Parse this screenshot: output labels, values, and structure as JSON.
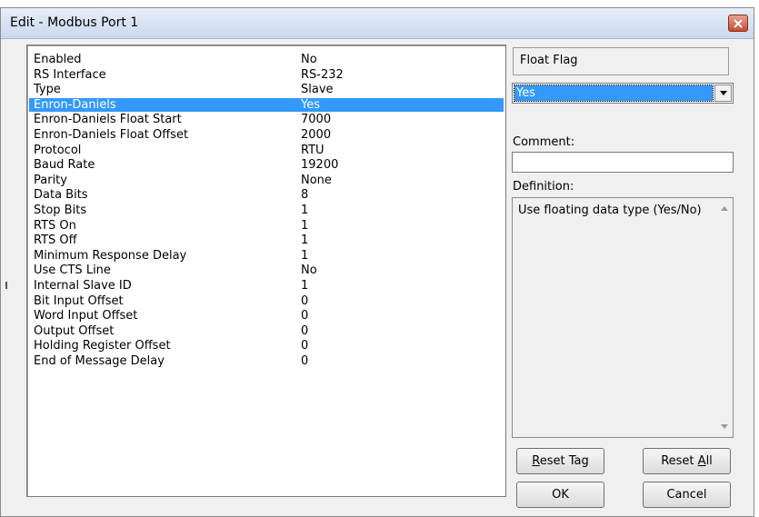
{
  "window": {
    "title": "Edit - Modbus Port 1"
  },
  "parameters": [
    {
      "name": "Enabled",
      "value": "No"
    },
    {
      "name": "RS Interface",
      "value": "RS-232"
    },
    {
      "name": "Type",
      "value": "Slave"
    },
    {
      "name": "Enron-Daniels",
      "value": "Yes",
      "selected": true
    },
    {
      "name": "Enron-Daniels Float Start",
      "value": "7000"
    },
    {
      "name": "Enron-Daniels Float Offset",
      "value": "2000"
    },
    {
      "name": "Protocol",
      "value": "RTU"
    },
    {
      "name": "Baud Rate",
      "value": "19200"
    },
    {
      "name": "Parity",
      "value": "None"
    },
    {
      "name": "Data Bits",
      "value": "8"
    },
    {
      "name": "Stop Bits",
      "value": "1"
    },
    {
      "name": "RTS On",
      "value": "1"
    },
    {
      "name": "RTS Off",
      "value": "1"
    },
    {
      "name": "Minimum Response Delay",
      "value": "1"
    },
    {
      "name": "Use CTS Line",
      "value": "No"
    },
    {
      "name": "Internal Slave ID",
      "value": "1"
    },
    {
      "name": "Bit Input Offset",
      "value": "0"
    },
    {
      "name": "Word Input Offset",
      "value": "0"
    },
    {
      "name": "Output Offset",
      "value": "0"
    },
    {
      "name": "Holding Register Offset",
      "value": "0"
    },
    {
      "name": "End of Message Delay",
      "value": "0"
    }
  ],
  "editor": {
    "field_label": "Float Flag",
    "selected_value": "Yes",
    "comment_label": "Comment:",
    "comment_value": "",
    "definition_label": "Definition:",
    "definition_text": "Use floating data type (Yes/No)"
  },
  "buttons": {
    "reset_tag_u": "R",
    "reset_tag_rest": "eset Tag",
    "reset_all_pre": "Reset ",
    "reset_all_u": "A",
    "reset_all_rest": "ll",
    "ok": "OK",
    "cancel": "Cancel"
  },
  "colors": {
    "selection": "#3399ff",
    "dialog_bg": "#f0f0f0",
    "close_button": "#c64a34"
  },
  "icons": [
    "close-icon",
    "dropdown-arrow-icon",
    "scroll-up-icon",
    "scroll-down-icon"
  ]
}
